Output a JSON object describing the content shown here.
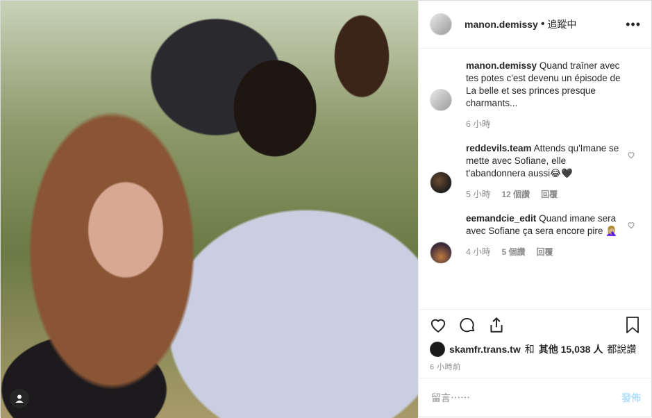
{
  "photo": {
    "alt_icon": "user-tag-icon"
  },
  "header": {
    "username": "manon.demissy",
    "separator": "•",
    "follow_status": "追蹤中",
    "more": "•••"
  },
  "comments": [
    {
      "user": "manon.demissy",
      "text": "Quand traîner avec tes potes c'est devenu un épisode de La belle et ses princes presque charmants...",
      "time": "6 小時",
      "likes": "",
      "reply": ""
    },
    {
      "user": "reddevils.team",
      "text": "Attends qu'Imane se mette avec Sofiane, elle t'abandonnera aussi😂🖤",
      "time": "5 小時",
      "likes": "12 個讚",
      "reply": "回覆"
    },
    {
      "user": "eemandcie_edit",
      "text": "Quand imane sera avec Sofiane ça sera encore pire 🤦🏼‍♀️",
      "time": "4 小時",
      "likes": "5 個讚",
      "reply": "回覆"
    }
  ],
  "likes": {
    "user": "skamfr.trans.tw",
    "connector": "和",
    "others": "其他 15,038 人",
    "suffix": "都說讚"
  },
  "timestamp": "6 小時前",
  "comment_box": {
    "placeholder": "留言⋯⋯",
    "post_label": "發佈"
  },
  "colors": {
    "link": "#b2dffc",
    "muted": "#8e8e8e",
    "text": "#262626"
  }
}
